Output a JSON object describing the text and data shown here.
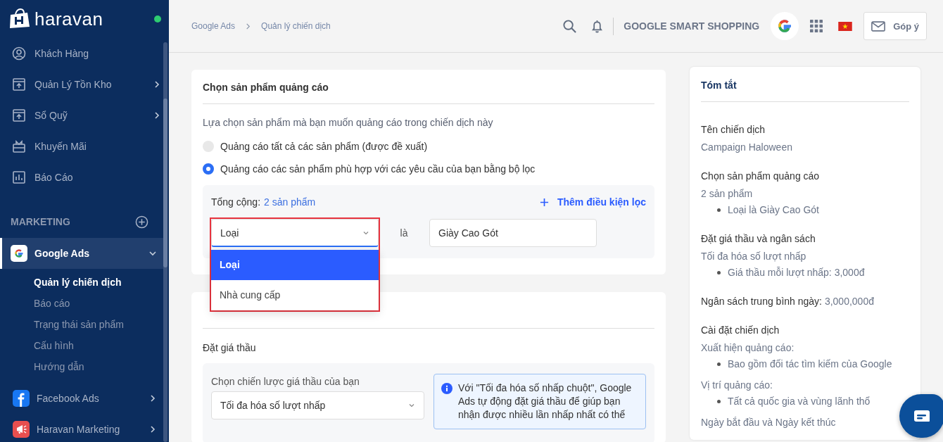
{
  "sidebar": {
    "brand": "haravan",
    "online": true,
    "items": [
      {
        "label": "Khách Hàng",
        "expandable": false
      },
      {
        "label": "Quản Lý Tồn Kho",
        "expandable": true
      },
      {
        "label": "Sổ Quỹ",
        "expandable": true
      },
      {
        "label": "Khuyến Mãi",
        "expandable": false
      },
      {
        "label": "Báo Cáo",
        "expandable": false
      }
    ],
    "section": "MARKETING",
    "apps": [
      {
        "label": "Google Ads",
        "selected": true,
        "expanded": true,
        "children": [
          {
            "label": "Quản lý chiến dịch",
            "selected": true
          },
          {
            "label": "Báo cáo",
            "selected": false
          },
          {
            "label": "Trạng thái sản phẩm",
            "selected": false
          },
          {
            "label": "Cấu hình",
            "selected": false
          },
          {
            "label": "Hướng dẫn",
            "selected": false
          }
        ]
      },
      {
        "label": "Facebook Ads",
        "selected": false,
        "expanded": false
      },
      {
        "label": "Haravan Marketing",
        "selected": false,
        "expanded": false
      }
    ]
  },
  "header": {
    "breadcrumb": [
      "Google Ads",
      "Quản lý chiến dịch"
    ],
    "app_title": "GOOGLE SMART SHOPPING",
    "feedback": "Góp ý"
  },
  "product_card": {
    "title": "Chọn sản phẩm quảng cáo",
    "intro": "Lựa chọn sản phẩm mà bạn muốn quảng cáo trong chiến dịch này",
    "options": [
      {
        "label": "Quảng cáo tất cả các sản phẩm (được đề xuất)",
        "selected": false
      },
      {
        "label": "Quảng cáo các sản phẩm phù hợp với các yêu cầu của bạn bằng bộ lọc",
        "selected": true
      }
    ],
    "filter": {
      "total_label": "Tổng cộng:",
      "total_value": "2 sản phẩm",
      "add_label": "Thêm điều kiện lọc",
      "field": "Loại",
      "open": true,
      "highlighted": true,
      "menu": [
        {
          "label": "Loại",
          "selected": true
        },
        {
          "label": "Nhà cung cấp",
          "selected": false
        }
      ],
      "operator": "là",
      "value": "Giày Cao Gót"
    }
  },
  "bid_card": {
    "subtitle": "Đặt giá thầu",
    "strategy_label": "Chọn chiến lược giá thầu của bạn",
    "strategy_value": "Tối đa hóa số lượt nhấp",
    "info": "Với \"Tối đa hóa số nhấp chuột\", Google Ads tự động đặt giá thầu để giúp bạn nhận được nhiều lần nhấp nhất có thể"
  },
  "summary": {
    "title": "Tóm tắt",
    "groups": [
      {
        "kind": "block",
        "heading": "Tên chiến dịch",
        "lines": [
          {
            "kind": "text",
            "text": "Campaign Haloween"
          }
        ]
      },
      {
        "kind": "block",
        "heading": "Chọn sản phẩm quảng cáo",
        "lines": [
          {
            "kind": "text",
            "text": "2 sản phẩm"
          },
          {
            "kind": "bullet",
            "text": "Loại là Giày Cao Gót"
          }
        ]
      },
      {
        "kind": "block",
        "heading": "Đặt giá thầu và ngân sách",
        "lines": [
          {
            "kind": "text",
            "text": "Tối đa hóa số lượt nhấp"
          },
          {
            "kind": "bullet",
            "text": "Giá thầu mỗi lượt nhấp: 3,000đ"
          }
        ]
      },
      {
        "kind": "inline",
        "heading": "Ngân sách trung bình ngày:",
        "value": "3,000,000đ"
      },
      {
        "kind": "block",
        "heading": "Cài đặt chiến dịch",
        "lines": [
          {
            "kind": "text",
            "text": "Xuất hiện quảng cáo:"
          },
          {
            "kind": "bullet",
            "text": "Bao gồm đối tác tìm kiếm của Google"
          },
          {
            "kind": "text",
            "text": "Vị trí quảng cáo:"
          },
          {
            "kind": "bullet",
            "text": "Tất cả quốc gia và vùng lãnh thổ"
          },
          {
            "kind": "text",
            "text": "Ngày bắt đầu và Ngày kết thúc"
          }
        ]
      }
    ]
  }
}
